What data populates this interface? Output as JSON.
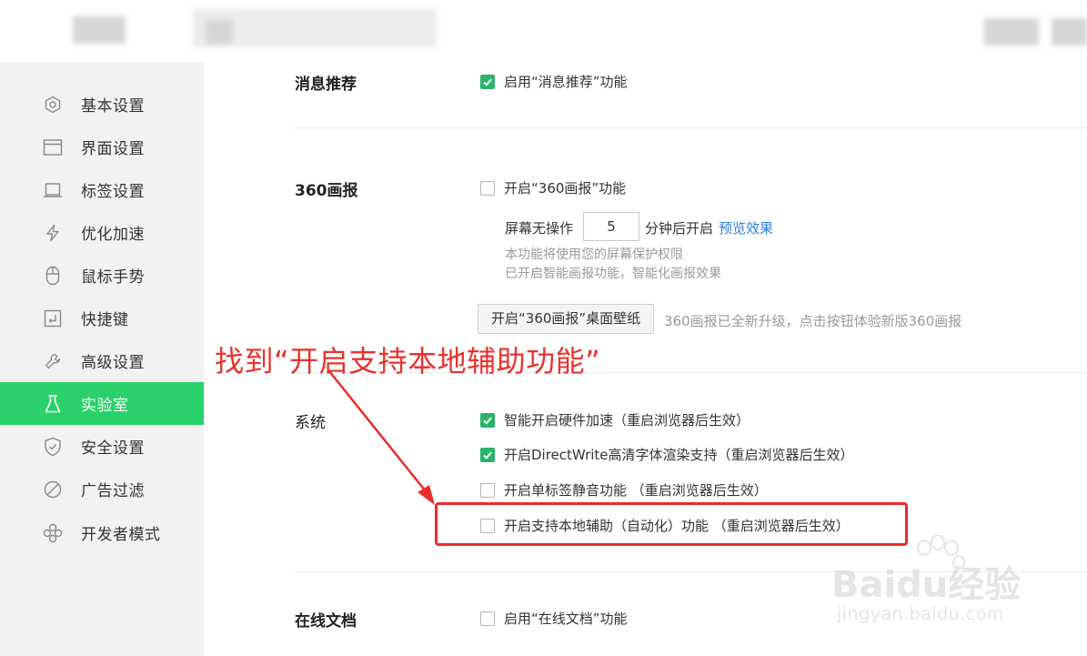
{
  "sidebar": {
    "items": [
      {
        "label": "基本设置",
        "icon": "settings-hexagon-icon"
      },
      {
        "label": "界面设置",
        "icon": "window-icon"
      },
      {
        "label": "标签设置",
        "icon": "tab-icon"
      },
      {
        "label": "优化加速",
        "icon": "lightning-icon"
      },
      {
        "label": "鼠标手势",
        "icon": "mouse-icon"
      },
      {
        "label": "快捷键",
        "icon": "keyboard-enter-icon"
      },
      {
        "label": "高级设置",
        "icon": "wrench-icon"
      },
      {
        "label": "实验室",
        "icon": "flask-icon",
        "active": true
      },
      {
        "label": "安全设置",
        "icon": "shield-icon"
      },
      {
        "label": "广告过滤",
        "icon": "block-icon"
      },
      {
        "label": "开发者模式",
        "icon": "puzzle-icon"
      }
    ]
  },
  "sections": {
    "news": {
      "title": "消息推荐",
      "option": {
        "label": "启用“消息推荐”功能",
        "checked": true
      }
    },
    "screensaver": {
      "title": "360画报",
      "option": {
        "label": "开启“360画报”功能",
        "checked": false
      },
      "idle_prefix": "屏幕无操作",
      "idle_minutes": "5",
      "idle_suffix": "分钟后开启",
      "preview_link": "预览效果",
      "hint1": "本功能将使用您的屏幕保护权限",
      "hint2": "已开启智能画报功能，智能化画报效果",
      "wallpaper_button": "开启“360画报”桌面壁纸",
      "wallpaper_hint": "360画报已全新升级，点击按钮体验新版360画报"
    },
    "system": {
      "title": "系统",
      "options": [
        {
          "label": "智能开启硬件加速（重启浏览器后生效）",
          "checked": true
        },
        {
          "label": "开启DirectWrite高清字体渲染支持（重启浏览器后生效）",
          "checked": true
        },
        {
          "label": "开启单标签静音功能 （重启浏览器后生效）",
          "checked": false
        },
        {
          "label": "开启支持本地辅助（自动化）功能 （重启浏览器后生效）",
          "checked": false
        }
      ]
    },
    "online_docs": {
      "title": "在线文档",
      "option": {
        "label": "启用“在线文档”功能",
        "checked": false
      }
    }
  },
  "annotation": {
    "text": "找到“开启支持本地辅助功能”",
    "color": "#e8322d"
  },
  "watermark": {
    "logo": "Baidu经验",
    "url": "jingyan.baidu.com"
  },
  "colors": {
    "accent": "#2ad16a",
    "checkbox": "#2ab36a",
    "link": "#2c7be5",
    "annotation": "#e62e2a"
  }
}
